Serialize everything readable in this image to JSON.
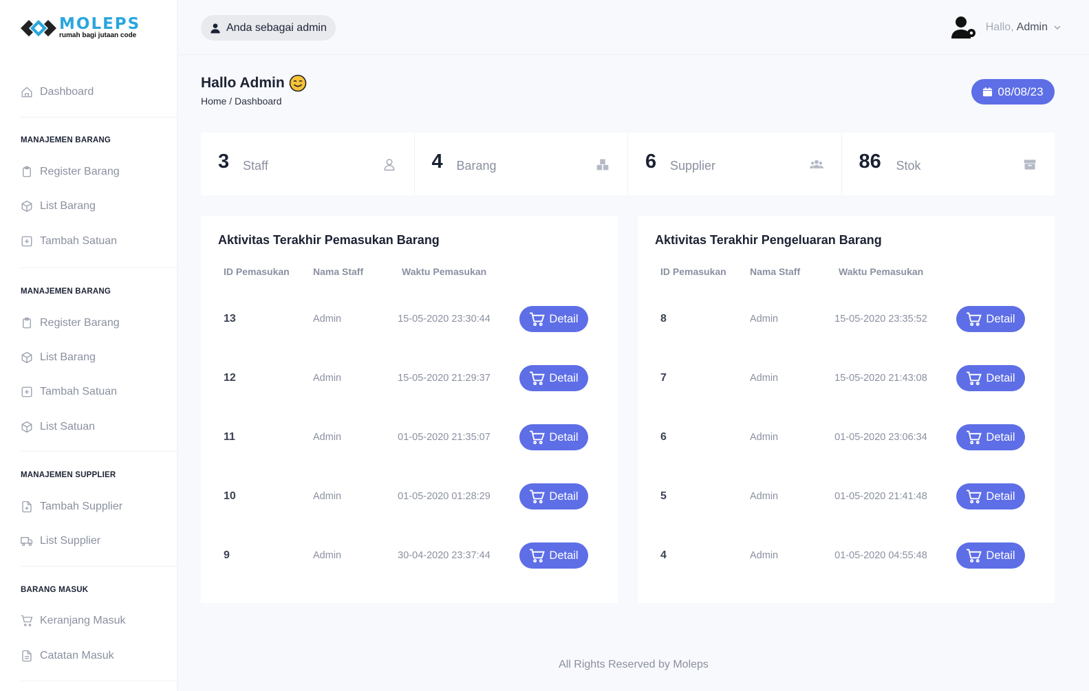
{
  "brand": {
    "name": "MOLEPS",
    "tagline": "rumah bagi jutaan code",
    "color": "#2aa6dc"
  },
  "colors": {
    "accent": "#5d6ee6",
    "muted": "#8a90a0"
  },
  "sidebar": {
    "dashboard": {
      "label": "Dashboard",
      "icon": "home-icon"
    },
    "sections": [
      {
        "title": "MANAJEMEN BARANG",
        "items": [
          {
            "label": "Register Barang",
            "icon": "clipboard-icon"
          },
          {
            "label": "List Barang",
            "icon": "box-icon"
          },
          {
            "label": "Tambah Satuan",
            "icon": "plus-square-icon"
          }
        ]
      },
      {
        "title": "MANAJEMEN BARANG",
        "items": [
          {
            "label": "Register Barang",
            "icon": "clipboard-icon"
          },
          {
            "label": "List Barang",
            "icon": "box-icon"
          },
          {
            "label": "Tambah Satuan",
            "icon": "plus-square-icon"
          },
          {
            "label": "List Satuan",
            "icon": "box-icon"
          }
        ]
      },
      {
        "title": "MANAJEMEN SUPPLIER",
        "items": [
          {
            "label": "Tambah Supplier",
            "icon": "file-plus-icon"
          },
          {
            "label": "List Supplier",
            "icon": "truck-icon"
          }
        ]
      },
      {
        "title": "BARANG MASUK",
        "items": [
          {
            "label": "Keranjang Masuk",
            "icon": "cart-icon"
          },
          {
            "label": "Catatan Masuk",
            "icon": "file-text-icon"
          }
        ]
      }
    ]
  },
  "topbar": {
    "role_label": "Anda sebagai admin",
    "greeting": "Hallo,",
    "user_name": "Admin"
  },
  "header": {
    "title": "Hallo Admin",
    "breadcrumb": "Home / Dashboard",
    "date": "08/08/23"
  },
  "stats": [
    {
      "value": "3",
      "label": "Staff",
      "icon": "user-icon"
    },
    {
      "value": "4",
      "label": "Barang",
      "icon": "boxes-icon"
    },
    {
      "value": "6",
      "label": "Supplier",
      "icon": "users-icon"
    },
    {
      "value": "86",
      "label": "Stok",
      "icon": "archive-icon"
    }
  ],
  "incoming": {
    "title": "Aktivitas Terakhir Pemasukan Barang",
    "columns": [
      "ID Pemasukan",
      "Nama Staff",
      "Waktu Pemasukan"
    ],
    "detail_label": "Detail",
    "rows": [
      {
        "id": "13",
        "staff": "Admin",
        "time": "15-05-2020 23:30:44"
      },
      {
        "id": "12",
        "staff": "Admin",
        "time": "15-05-2020 21:29:37"
      },
      {
        "id": "11",
        "staff": "Admin",
        "time": "01-05-2020 21:35:07"
      },
      {
        "id": "10",
        "staff": "Admin",
        "time": "01-05-2020 01:28:29"
      },
      {
        "id": "9",
        "staff": "Admin",
        "time": "30-04-2020 23:37:44"
      }
    ]
  },
  "outgoing": {
    "title": "Aktivitas Terakhir Pengeluaran Barang",
    "columns": [
      "ID Pemasukan",
      "Nama Staff",
      "Waktu Pemasukan"
    ],
    "detail_label": "Detail",
    "rows": [
      {
        "id": "8",
        "staff": "Admin",
        "time": "15-05-2020 23:35:52"
      },
      {
        "id": "7",
        "staff": "Admin",
        "time": "15-05-2020 21:43:08"
      },
      {
        "id": "6",
        "staff": "Admin",
        "time": "01-05-2020 23:06:34"
      },
      {
        "id": "5",
        "staff": "Admin",
        "time": "01-05-2020 21:41:48"
      },
      {
        "id": "4",
        "staff": "Admin",
        "time": "01-05-2020 04:55:48"
      }
    ]
  },
  "footer": {
    "text": "All Rights Reserved by Moleps"
  }
}
